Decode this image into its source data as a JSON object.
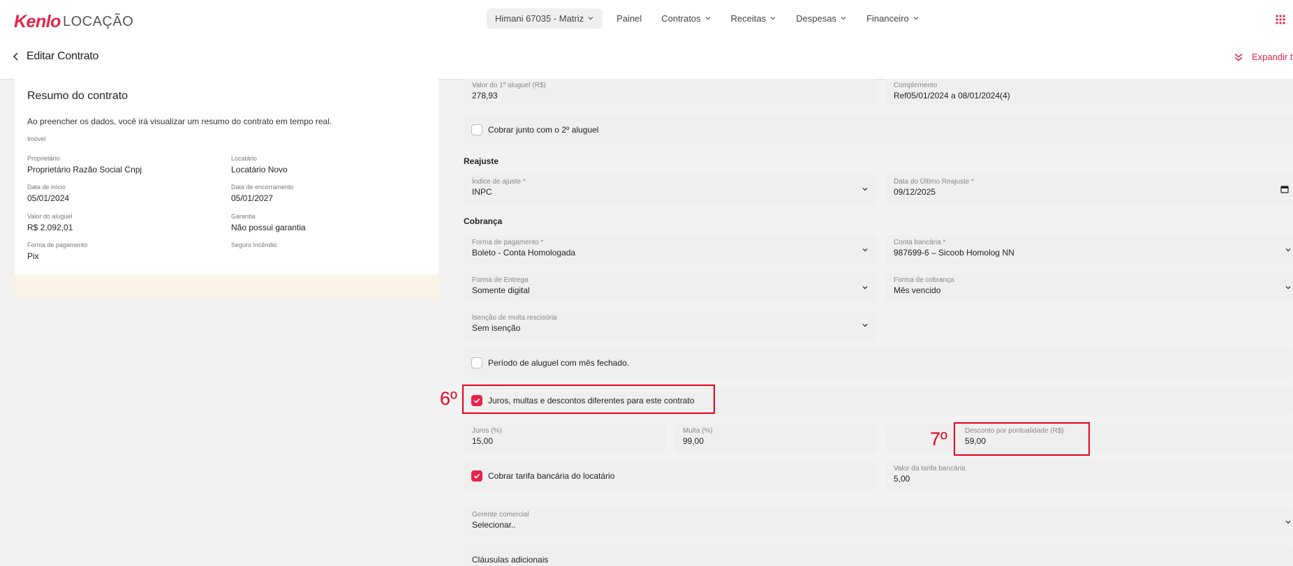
{
  "app": {
    "brand": "Kenlo",
    "product": "LOCAÇÃO"
  },
  "nav": {
    "company": "Himani 67035 - Matriz",
    "items": [
      "Painel",
      "Contratos",
      "Receitas",
      "Despesas",
      "Financeiro"
    ]
  },
  "subbar": {
    "back_label": "Editar Contrato",
    "expand_label": "Expandir t"
  },
  "summary": {
    "title": "Resumo do contrato",
    "intro": "Ao preencher os dados, você irá visualizar um resumo do contrato em tempo real.",
    "imovel_label": "Imóvel",
    "fields": [
      {
        "label": "Proprietário",
        "value": "Proprietário Razão Social Cnpj"
      },
      {
        "label": "Locatário",
        "value": "Locatário Novo"
      },
      {
        "label": "Data de início",
        "value": "05/01/2024"
      },
      {
        "label": "Data de encerramento",
        "value": "05/01/2027"
      },
      {
        "label": "Valor do aluguel",
        "value": "R$ 2.092,01"
      },
      {
        "label": "Garantia",
        "value": "Não possui garantia"
      },
      {
        "label": "Forma de pagamento",
        "value": "Pix"
      },
      {
        "label": "Seguro Incêndio",
        "value": ""
      }
    ]
  },
  "form": {
    "primeiro_aluguel": {
      "label": "Valor do 1º aluguel (R$)",
      "value": "278,93"
    },
    "complemento": {
      "label": "Complemento",
      "value": "Ref05/01/2024 a 08/01/2024(4)"
    },
    "cobrar_junto": {
      "label": "Cobrar junto com o 2º aluguel",
      "checked": false
    },
    "reajuste_title": "Reajuste",
    "indice": {
      "label": "Índice de ajuste *",
      "value": "INPC"
    },
    "ultimo_reajuste": {
      "label": "Data do Último Reajuste *",
      "value": "09/12/2025"
    },
    "cobranca_title": "Cobrança",
    "forma_pagamento": {
      "label": "Forma de pagamento *",
      "value": "Boleto - Conta Homologada"
    },
    "conta_bancaria": {
      "label": "Conta bancária *",
      "value": "987699-6 – Sicoob Homolog NN"
    },
    "forma_entrega": {
      "label": "Forma de Entrega",
      "value": "Somente digital"
    },
    "forma_cobranca": {
      "label": "Forma de cobrança",
      "value": "Mês vencido"
    },
    "isencao": {
      "label": "Isenção de multa rescisória",
      "value": "Sem isenção"
    },
    "periodo": {
      "label": "Período de aluguel com mês fechado.",
      "checked": false
    },
    "juros_diferentes": {
      "label": "Juros, multas e descontos diferentes para este contrato",
      "checked": true
    },
    "juros": {
      "label": "Juros (%)",
      "value": "15,00"
    },
    "multa": {
      "label": "Multa (%)",
      "value": "99,00"
    },
    "desconto": {
      "label": "Desconto por pontualidade (R$)",
      "value": "59,00"
    },
    "cobrar_tarifa": {
      "label": "Cobrar tarifa bancária do locatário",
      "checked": true
    },
    "valor_tarifa": {
      "label": "Valor da tarifa bancária",
      "value": "5,00"
    },
    "gerente": {
      "label": "Gerente comercial",
      "value": "Selecionar.."
    },
    "clausulas": {
      "label": "Cláusulas adicionais"
    }
  },
  "annotations": {
    "step6": "6º",
    "step7": "7º"
  },
  "colors": {
    "accent": "#e4244a",
    "annotation": "#e3001b",
    "field_bg": "#efefef",
    "page_bg": "#f2f2f2"
  }
}
